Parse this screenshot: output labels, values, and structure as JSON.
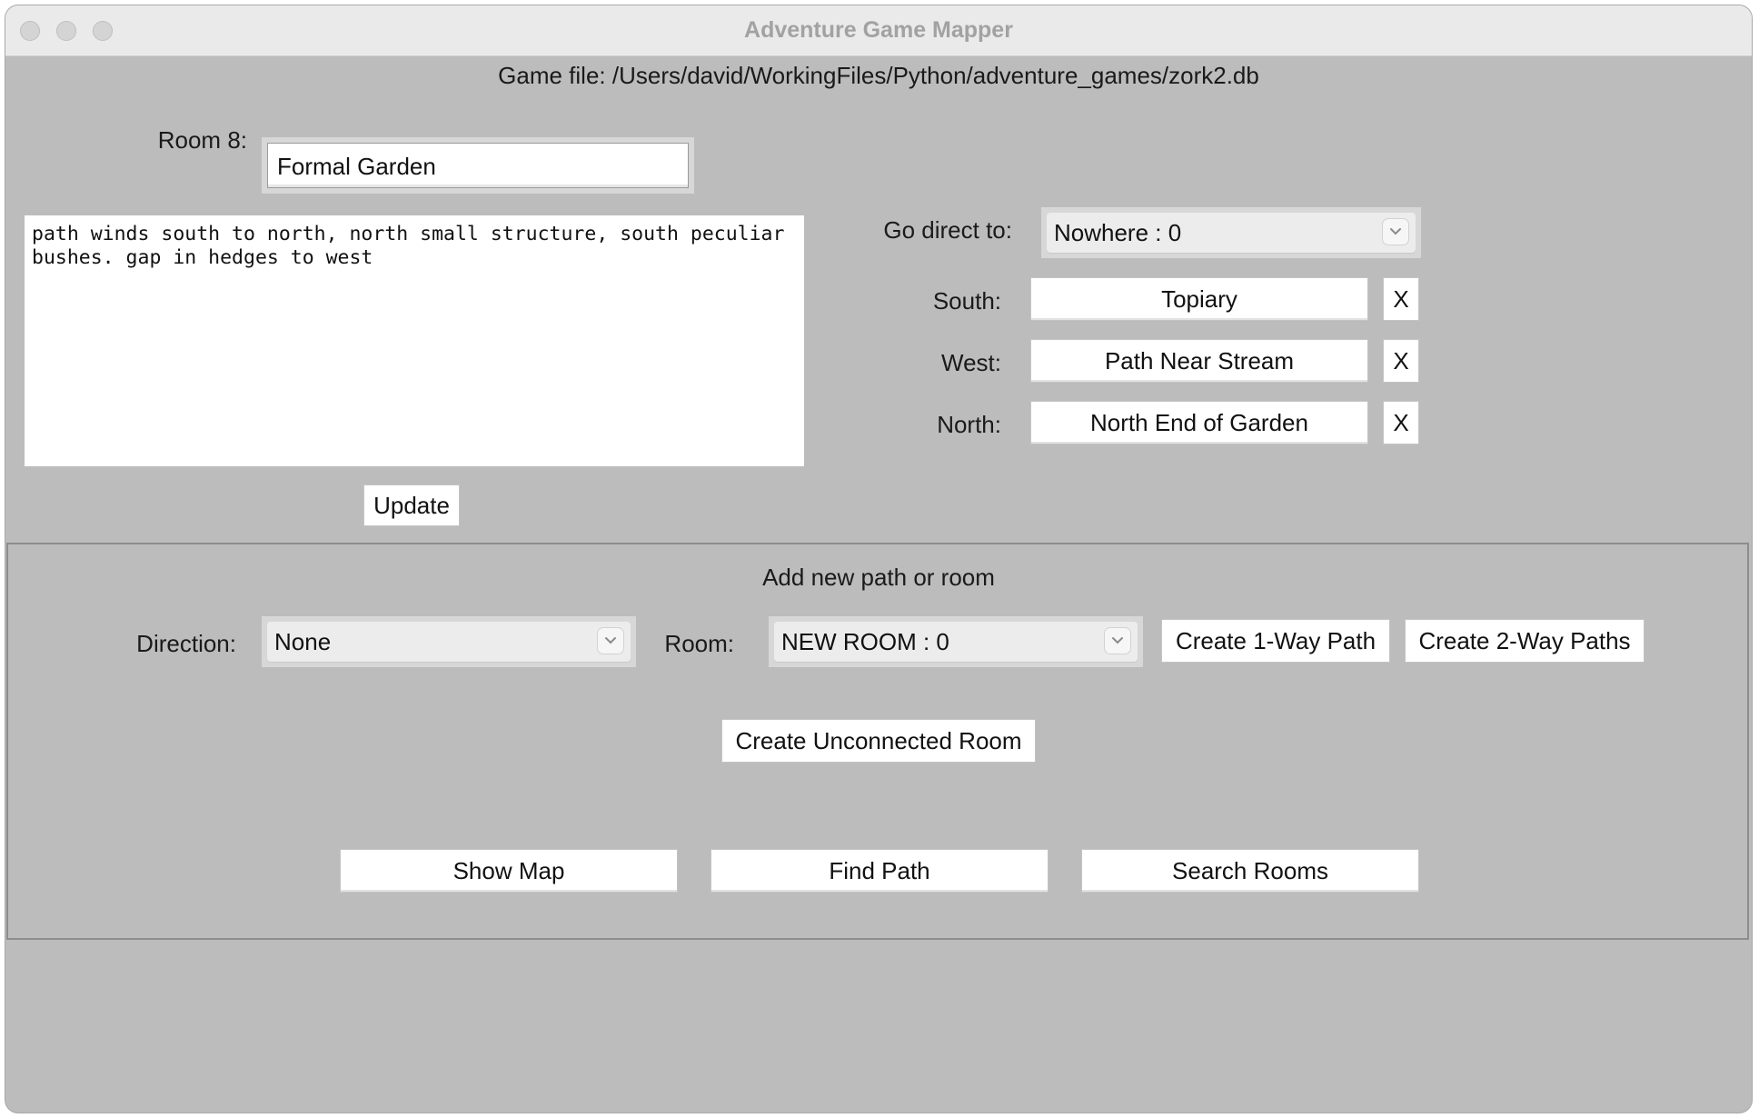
{
  "window": {
    "title": "Adventure Game Mapper"
  },
  "game_file": {
    "text": "Game file: /Users/david/WorkingFiles/Python/adventure_games/zork2.db"
  },
  "room": {
    "label": "Room 8:",
    "name_value": "Formal Garden",
    "description": "path winds south to north, north small structure, south peculiar bushes. gap in hedges to west",
    "update_label": "Update"
  },
  "exits": {
    "go_direct_label": "Go direct to:",
    "go_direct_value": "Nowhere : 0",
    "items": [
      {
        "direction": "South:",
        "destination": "Topiary",
        "remove_label": "X"
      },
      {
        "direction": "West:",
        "destination": "Path Near Stream",
        "remove_label": "X"
      },
      {
        "direction": "North:",
        "destination": "North End of Garden",
        "remove_label": "X"
      }
    ]
  },
  "add_section": {
    "heading": "Add new path or room",
    "direction_label": "Direction:",
    "direction_value": "None",
    "room_label": "Room:",
    "room_value": "NEW ROOM : 0",
    "create_one_way": "Create 1-Way Path",
    "create_two_way": "Create 2-Way Paths",
    "create_unconnected": "Create Unconnected Room"
  },
  "bottom_buttons": {
    "show_map": "Show Map",
    "find_path": "Find Path",
    "search_rooms": "Search Rooms"
  },
  "icons": {
    "window_controls": [
      "close-icon",
      "minimize-icon",
      "zoom-icon"
    ],
    "dropdown": "chevron-down-icon"
  },
  "colors": {
    "window_background": "#bcbcbc",
    "titlebar": "#eaeaea",
    "title_text": "#a2a2a2"
  }
}
